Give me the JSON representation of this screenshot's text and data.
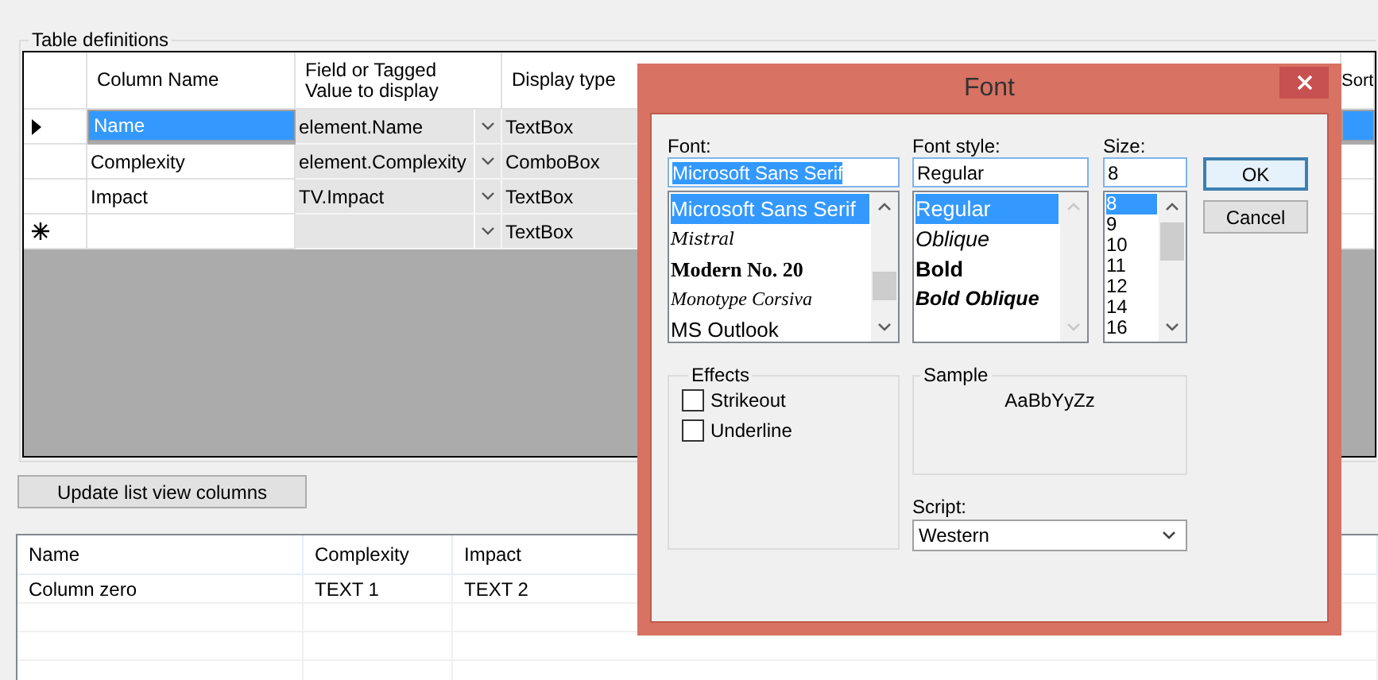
{
  "group_title": "Table definitions",
  "grid": {
    "columns": [
      "Column Name",
      "Field or Tagged Value to display",
      "Display type"
    ],
    "last_column": "Sort",
    "rows": [
      {
        "kind": "data",
        "selected": true,
        "name": "Name",
        "field": "element.Name",
        "display": "TextBox"
      },
      {
        "kind": "data",
        "selected": false,
        "name": "Complexity",
        "field": "element.Complexity",
        "display": "ComboBox"
      },
      {
        "kind": "data",
        "selected": false,
        "name": "Impact",
        "field": "TV.Impact",
        "display": "TextBox"
      },
      {
        "kind": "new",
        "selected": false,
        "display": "TextBox"
      }
    ]
  },
  "update_button": "Update list view columns",
  "list_view": {
    "columns": [
      "Name",
      "Complexity",
      "Impact"
    ],
    "rows": [
      [
        "Column zero",
        "TEXT 1",
        "TEXT 2"
      ]
    ]
  },
  "dialog": {
    "title": "Font",
    "font": {
      "label": "Font:",
      "value": "Microsoft Sans Serif",
      "items": [
        {
          "text": "Microsoft Sans Serif",
          "selected": true
        },
        {
          "text": "Mistral",
          "selected": false
        },
        {
          "text": "Modern No. 20",
          "selected": false
        },
        {
          "text": "Monotype Corsiva",
          "selected": false
        },
        {
          "text": "MS Outlook",
          "selected": false
        }
      ]
    },
    "style": {
      "label": "Font style:",
      "value": "Regular",
      "items": [
        {
          "text": "Regular",
          "selected": true
        },
        {
          "text": "Oblique",
          "selected": false
        },
        {
          "text": "Bold",
          "selected": false
        },
        {
          "text": "Bold Oblique",
          "selected": false
        }
      ]
    },
    "size": {
      "label": "Size:",
      "value": "8",
      "items": [
        {
          "text": "8",
          "selected": true
        },
        {
          "text": "9",
          "selected": false
        },
        {
          "text": "10",
          "selected": false
        },
        {
          "text": "11",
          "selected": false
        },
        {
          "text": "12",
          "selected": false
        },
        {
          "text": "14",
          "selected": false
        },
        {
          "text": "16",
          "selected": false
        }
      ]
    },
    "buttons": [
      "OK",
      "Cancel"
    ],
    "effects": {
      "title": "Effects",
      "options": [
        {
          "label": "Strikeout",
          "checked": false
        },
        {
          "label": "Underline",
          "checked": false
        }
      ]
    },
    "sample": {
      "title": "Sample",
      "text": "AaBbYyZz"
    },
    "script": {
      "label": "Script:",
      "value": "Western"
    }
  }
}
